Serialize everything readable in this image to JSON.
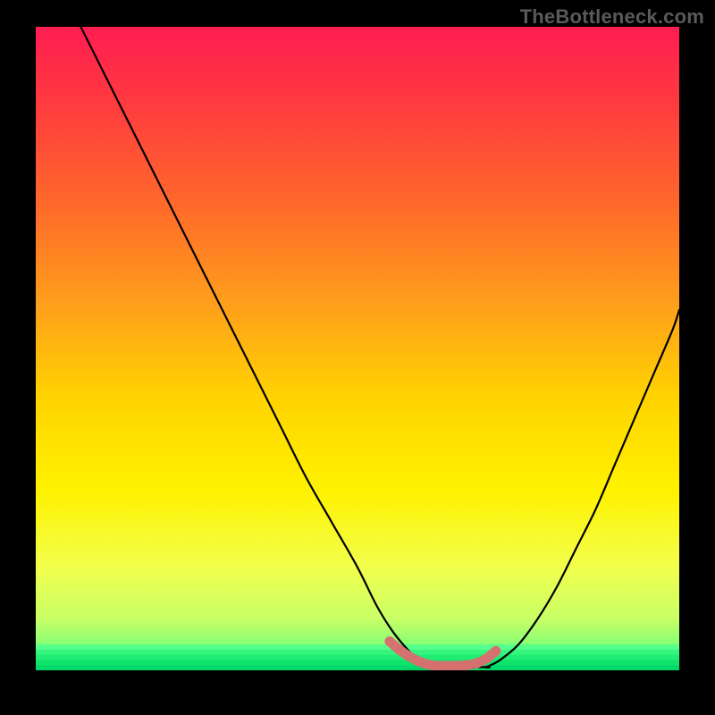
{
  "watermark": "TheBottleneck.com",
  "colors": {
    "black": "#000000",
    "curve": "#000000",
    "marker": "#d6706f",
    "green_band_top": "#4ff08a",
    "green_band_bottom": "#00d968"
  },
  "chart_data": {
    "type": "line",
    "title": "",
    "xlabel": "",
    "ylabel": "",
    "xlim": [
      0,
      100
    ],
    "ylim": [
      0,
      100
    ],
    "gradient_stops": [
      {
        "offset": 0.0,
        "color": "#ff1d52"
      },
      {
        "offset": 0.12,
        "color": "#ff3b3f"
      },
      {
        "offset": 0.28,
        "color": "#ff6a2a"
      },
      {
        "offset": 0.44,
        "color": "#ffa21a"
      },
      {
        "offset": 0.58,
        "color": "#ffd400"
      },
      {
        "offset": 0.72,
        "color": "#fff200"
      },
      {
        "offset": 0.84,
        "color": "#f2ff4d"
      },
      {
        "offset": 0.92,
        "color": "#c8ff66"
      },
      {
        "offset": 0.965,
        "color": "#7fff76"
      },
      {
        "offset": 1.0,
        "color": "#00e56e"
      }
    ],
    "series": [
      {
        "name": "bottleneck-curve-left",
        "x": [
          7,
          10,
          14,
          18,
          22,
          26,
          30,
          34,
          38,
          42,
          46,
          50,
          53,
          55.5,
          58,
          60,
          62
        ],
        "y": [
          100,
          94,
          86,
          78,
          70,
          62,
          54,
          46,
          38,
          30,
          23,
          16,
          10,
          6,
          3,
          1.2,
          0.5
        ]
      },
      {
        "name": "bottleneck-curve-right",
        "x": [
          70,
          72,
          75,
          78,
          81,
          84,
          87,
          90,
          93,
          96,
          99,
          100
        ],
        "y": [
          0.5,
          1.5,
          4,
          8,
          13,
          19,
          25,
          32,
          39,
          46,
          53,
          56
        ]
      }
    ],
    "flat_region": {
      "x": [
        62,
        70
      ],
      "y": [
        0.5,
        0.5
      ]
    },
    "markers": {
      "name": "bottleneck-range",
      "x": [
        55,
        56.5,
        58,
        59.5,
        61,
        62.5,
        64,
        65.5,
        67,
        68.5,
        70,
        71.5
      ],
      "y": [
        4.5,
        3.2,
        2.2,
        1.4,
        0.9,
        0.7,
        0.7,
        0.7,
        0.8,
        1.1,
        1.8,
        3.0
      ]
    },
    "green_band": {
      "y0": 0,
      "y1": 4
    }
  }
}
